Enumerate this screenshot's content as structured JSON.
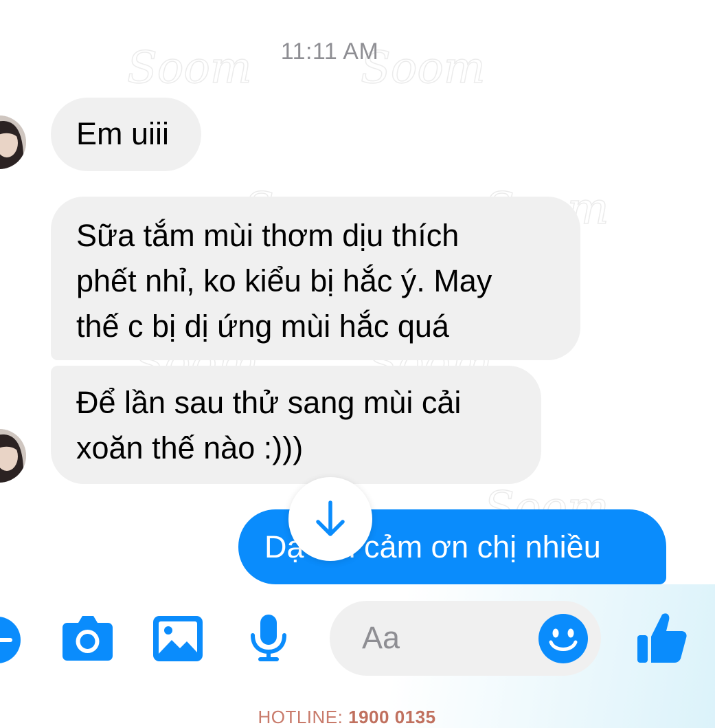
{
  "timestamp": "11:11 AM",
  "messages": {
    "incoming_1": "Em uiii",
    "incoming_2_lines": [
      "Sữa tắm mùi thơm dịu thích",
      "phết nhỉ, ko kiểu bị hắc ý. May",
      "thế c bị dị ứng mùi hắc quá"
    ],
    "incoming_3_lines": [
      "Để lần sau thử sang mùi cải",
      "xoăn thế nào :)))"
    ],
    "outgoing_1": "Dạ em cảm ơn chị nhiều"
  },
  "composer": {
    "placeholder": "Aa"
  },
  "icons": {
    "scroll": "arrow-down-icon",
    "plus": "plus-icon",
    "camera": "camera-icon",
    "gallery": "image-icon",
    "mic": "microphone-icon",
    "emoji": "emoji-icon",
    "like": "thumbs-up-icon"
  },
  "colors": {
    "accent": "#0a8cfc",
    "incoming_bubble": "#f0f0f0",
    "outgoing_text": "#ffffff",
    "hotline": "#c87a6a"
  },
  "footer": {
    "label": "HOTLINE:",
    "number": "1900 0135"
  },
  "watermark": {
    "text": "Soom"
  }
}
